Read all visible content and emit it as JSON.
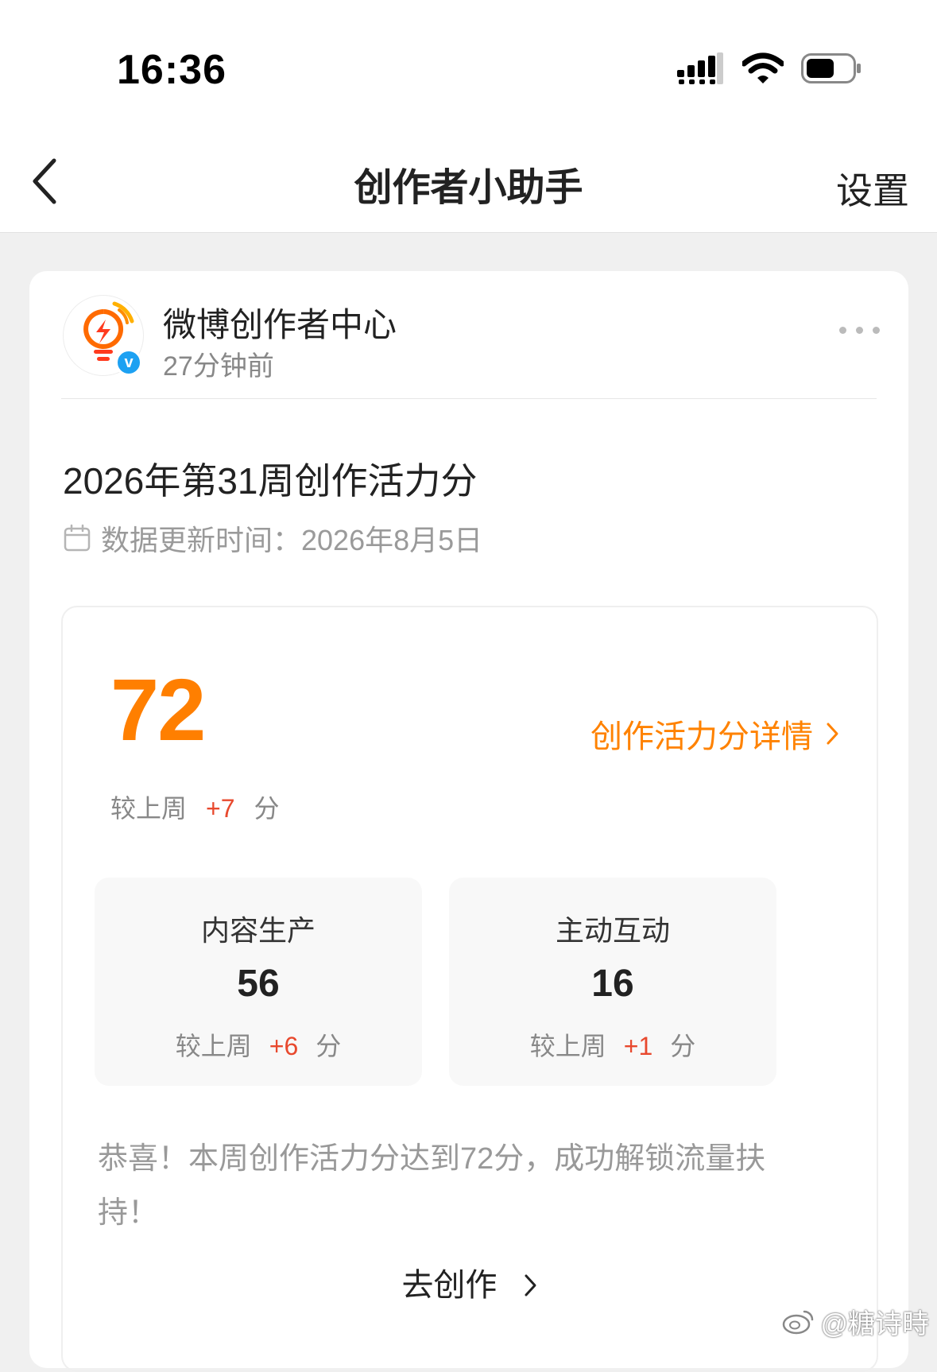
{
  "status_bar": {
    "time": "16:36"
  },
  "nav": {
    "back_icon": "chevron-left-icon",
    "title": "创作者小助手",
    "settings_label": "设置"
  },
  "account": {
    "name": "微博创作者中心",
    "time_ago": "27分钟前",
    "verified_mark": "v"
  },
  "post": {
    "title": "2026年第31周创作活力分",
    "update_time": "数据更新时间：2026年8月5日"
  },
  "score": {
    "value": "72",
    "detail_link": "创作活力分详情",
    "compare_prefix": "较上周",
    "compare_delta": "+7",
    "compare_unit": "分"
  },
  "metrics": [
    {
      "label": "内容生产",
      "value": "56",
      "compare_prefix": "较上周",
      "delta": "+6",
      "unit": "分"
    },
    {
      "label": "主动互动",
      "value": "16",
      "compare_prefix": "较上周",
      "delta": "+1",
      "unit": "分"
    }
  ],
  "message": "恭喜！本周创作活力分达到72分，成功解锁流量扶持！",
  "cta": {
    "label": "去创作"
  },
  "watermark": "@糖诗時",
  "colors": {
    "accent": "#ff8200",
    "delta": "#e8492e",
    "verified": "#1da1f2"
  }
}
